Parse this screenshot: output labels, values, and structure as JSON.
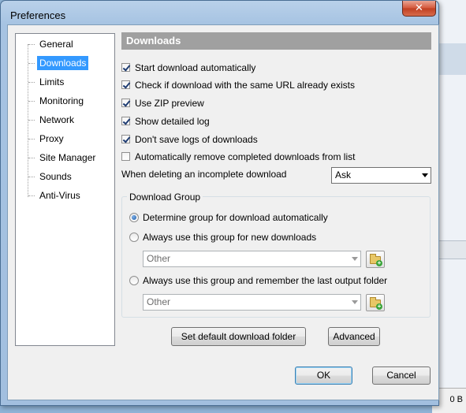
{
  "window": {
    "title": "Preferences",
    "close_glyph": "✕"
  },
  "tree": {
    "items": [
      {
        "label": "General",
        "selected": false
      },
      {
        "label": "Downloads",
        "selected": true
      },
      {
        "label": "Limits",
        "selected": false
      },
      {
        "label": "Monitoring",
        "selected": false
      },
      {
        "label": "Network",
        "selected": false
      },
      {
        "label": "Proxy",
        "selected": false
      },
      {
        "label": "Site Manager",
        "selected": false
      },
      {
        "label": "Sounds",
        "selected": false
      },
      {
        "label": "Anti-Virus",
        "selected": false
      }
    ]
  },
  "downloads": {
    "header": "Downloads",
    "options": [
      {
        "label": "Start download automatically",
        "checked": true
      },
      {
        "label": "Check if download with the same URL already exists",
        "checked": true
      },
      {
        "label": "Use ZIP preview",
        "checked": true
      },
      {
        "label": "Show detailed log",
        "checked": true
      },
      {
        "label": "Don't save logs of downloads",
        "checked": true
      },
      {
        "label": "Automatically remove completed downloads from list",
        "checked": false
      }
    ],
    "delete_incomplete_label": "When deleting an incomplete download",
    "delete_incomplete_value": "Ask",
    "group": {
      "legend": "Download Group",
      "radio_auto": "Determine group for download automatically",
      "radio_always_new": "Always use this group for new downloads",
      "combo1_value": "Other",
      "radio_remember": "Always use this group and remember the last output folder",
      "combo2_value": "Other",
      "selected": "auto"
    },
    "set_default_folder_label": "Set default download folder",
    "advanced_label": "Advanced"
  },
  "footer": {
    "ok_label": "OK",
    "cancel_label": "Cancel"
  },
  "background": {
    "status_text": "0 B"
  }
}
